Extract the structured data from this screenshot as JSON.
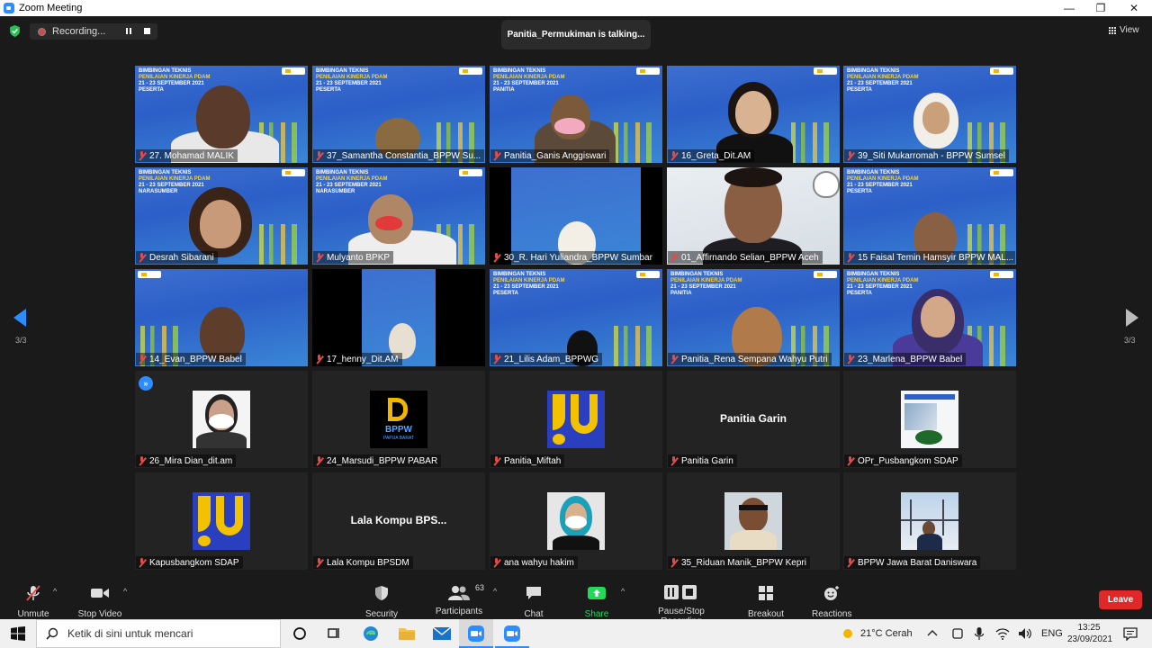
{
  "window": {
    "title": "Zoom Meeting",
    "controls": [
      "—",
      "❐",
      "✕"
    ]
  },
  "recording": {
    "label": "Recording..."
  },
  "talking": {
    "text": "Panitia_Permukiman is talking..."
  },
  "view": {
    "label": "View"
  },
  "pagination": {
    "left": "3/3",
    "right": "3/3"
  },
  "banner": {
    "line1": "BIMBINGAN TEKNIS",
    "line2": "PENILAIAN KINERJA PDAM",
    "line3": "21 - 23 SEPTEMBER 2021",
    "peserta": "PESERTA",
    "panitia": "PANITIA",
    "narasumber": "NARASUMBER"
  },
  "tiles": [
    {
      "name": "27. Mohamad MALIK"
    },
    {
      "name": "37_Samantha Constantia_BPPW Su..."
    },
    {
      "name": "Panitia_Ganis Anggiswari"
    },
    {
      "name": "16_Greta_Dit.AM"
    },
    {
      "name": "39_Siti Mukarromah - BPPW Sumsel"
    },
    {
      "name": "Desrah Sibarani"
    },
    {
      "name": "Mulyanto BPKP"
    },
    {
      "name": "30_R. Hari Yuliandra_BPPW Sumbar"
    },
    {
      "name": "01_Affirnando Selian_BPPW Aceh"
    },
    {
      "name": "15 Faisal Temin Hamsyir BPPW MAL..."
    },
    {
      "name": "14_Evan_BPPW Babel"
    },
    {
      "name": "17_henny_Dit.AM"
    },
    {
      "name": "21_Lilis Adam_BPPWG"
    },
    {
      "name": "Panitia_Rena Sempana Wahyu Putri"
    },
    {
      "name": "23_Marlena_BPPW Babel"
    },
    {
      "name": "26_Mira Dian_dit.am"
    },
    {
      "name": "24_Marsudi_BPPW PABAR",
      "logo_text": "BPPW",
      "logo_sub": "PAPUA BARAT"
    },
    {
      "name": "Panitia_Miftah"
    },
    {
      "name": "Panitia Garin",
      "center": "Panitia Garin"
    },
    {
      "name": "OPr_Pusbangkom SDAP"
    },
    {
      "name": "Kapusbangkom SDAP"
    },
    {
      "name": "Lala Kompu BPSDM",
      "center": "Lala Kompu BPS..."
    },
    {
      "name": "ana wahyu hakim"
    },
    {
      "name": "35_Riduan Manik_BPPW Kepri"
    },
    {
      "name": "BPPW Jawa Barat Daniswara"
    }
  ],
  "controls": {
    "unmute": "Unmute",
    "stop_video": "Stop Video",
    "security": "Security",
    "participants": "Participants",
    "participants_count": "63",
    "chat": "Chat",
    "share_screen": "Share Screen",
    "pause_stop_recording": "Pause/Stop Recording",
    "breakout_rooms": "Breakout Rooms",
    "reactions": "Reactions",
    "leave": "Leave"
  },
  "colors": {
    "accent": "#2d8cff",
    "share": "#23d959",
    "leave": "#e02828",
    "muted": "#e04b4b"
  },
  "taskbar": {
    "search_placeholder": "Ketik di sini untuk mencari",
    "weather": "21°C  Cerah",
    "lang": "ENG",
    "time": "13:25",
    "date": "23/09/2021"
  }
}
